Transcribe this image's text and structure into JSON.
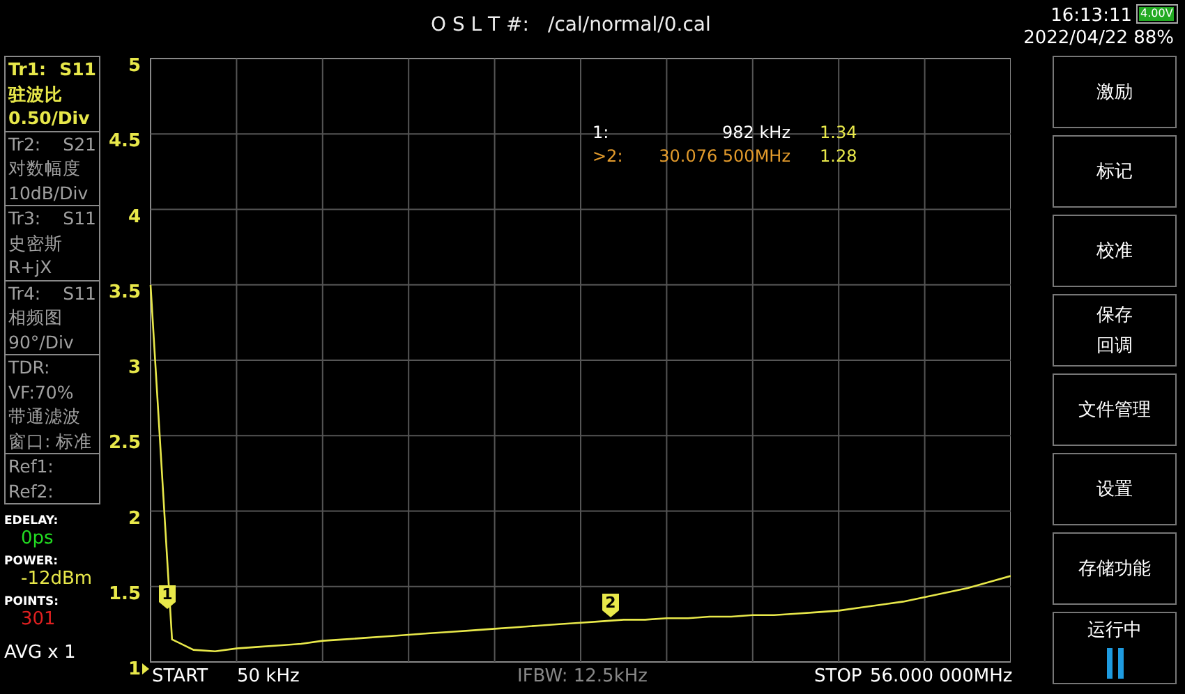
{
  "header": {
    "oslt_label": "O S L T #:",
    "cal_file": "/cal/normal/0.cal",
    "time": "16:13:11",
    "date": "2022/04/22",
    "battery_voltage": "4.00V",
    "battery_percent": "88%"
  },
  "traces": [
    {
      "name": "Tr1:",
      "param": "S11",
      "lines": [
        "驻波比",
        "0.50/Div"
      ],
      "selected": true
    },
    {
      "name": "Tr2:",
      "param": "S21",
      "lines": [
        "对数幅度",
        "10dB/Div"
      ],
      "selected": false
    },
    {
      "name": "Tr3:",
      "param": "S11",
      "lines": [
        "史密斯",
        "R+jX"
      ],
      "selected": false
    },
    {
      "name": "Tr4:",
      "param": "S11",
      "lines": [
        "相频图",
        "90°/Div"
      ],
      "selected": false
    }
  ],
  "tdr": [
    "TDR:",
    "VF:70%",
    "带通滤波",
    "窗口: 标准"
  ],
  "refs": [
    "Ref1:",
    "Ref2:"
  ],
  "status": [
    {
      "label": "EDELAY:",
      "value": "0ps",
      "color": "#22dd22"
    },
    {
      "label": "POWER:",
      "value": "-12dBm",
      "color": "#e8e84a"
    },
    {
      "label": "POINTS:",
      "value": "301",
      "color": "#e02020"
    }
  ],
  "avg": "AVG x 1",
  "marker_readout": [
    {
      "label": "1:",
      "frequency": "982 kHz",
      "value": "1.34",
      "selected": false
    },
    {
      "label": ">2:",
      "frequency": "30.076 500MHz",
      "value": "1.28",
      "selected": true
    }
  ],
  "chart_data": {
    "type": "line",
    "grid": true,
    "ylim": [
      1,
      5
    ],
    "yticks": [
      {
        "value": 1,
        "label": "1"
      },
      {
        "value": 1.5,
        "label": "1.5"
      },
      {
        "value": 2,
        "label": "2"
      },
      {
        "value": 2.5,
        "label": "2.5"
      },
      {
        "value": 3,
        "label": "3"
      },
      {
        "value": 3.5,
        "label": "3.5"
      },
      {
        "value": 4,
        "label": "4"
      },
      {
        "value": 4.5,
        "label": "4.5"
      },
      {
        "value": 5,
        "label": "5"
      }
    ],
    "categories": [
      null,
      null,
      null,
      null,
      null,
      null,
      null,
      null,
      null,
      null,
      null,
      null,
      null,
      null,
      null,
      null,
      null,
      null,
      null,
      null,
      null,
      null,
      null,
      null,
      null,
      null,
      null,
      null,
      null,
      null,
      null,
      null,
      null,
      null,
      null,
      null,
      null,
      null,
      null,
      null,
      null
    ],
    "series": [
      {
        "color": "#e8e84a",
        "values": [
          3.5,
          1.15,
          1.08,
          1.07,
          1.09,
          1.1,
          1.11,
          1.12,
          1.14,
          1.15,
          1.16,
          1.17,
          1.18,
          1.19,
          1.2,
          1.21,
          1.22,
          1.23,
          1.24,
          1.25,
          1.26,
          1.27,
          1.28,
          1.28,
          1.29,
          1.29,
          1.3,
          1.3,
          1.31,
          1.31,
          1.32,
          1.33,
          1.34,
          1.36,
          1.38,
          1.4,
          1.43,
          1.46,
          1.49,
          1.53,
          1.57
        ]
      }
    ]
  },
  "marker_flags": [
    {
      "label": "1"
    },
    {
      "label": "2"
    }
  ],
  "footer": {
    "start_label": "START",
    "start_value": "50 kHz",
    "ifbw": "IFBW: 12.5kHz",
    "stop_label": "STOP",
    "stop_value": "56.000 000MHz"
  },
  "menu": [
    {
      "kind": "button",
      "lines": [
        "激励"
      ]
    },
    {
      "kind": "button",
      "lines": [
        "标记"
      ]
    },
    {
      "kind": "button",
      "lines": [
        "校准"
      ]
    },
    {
      "kind": "button",
      "lines": [
        "保存",
        "回调"
      ]
    },
    {
      "kind": "button",
      "lines": [
        "文件管理"
      ]
    },
    {
      "kind": "button",
      "lines": [
        "设置"
      ]
    },
    {
      "kind": "button",
      "lines": [
        "存储功能"
      ]
    },
    {
      "kind": "run",
      "lines": [
        "运行中"
      ]
    }
  ]
}
